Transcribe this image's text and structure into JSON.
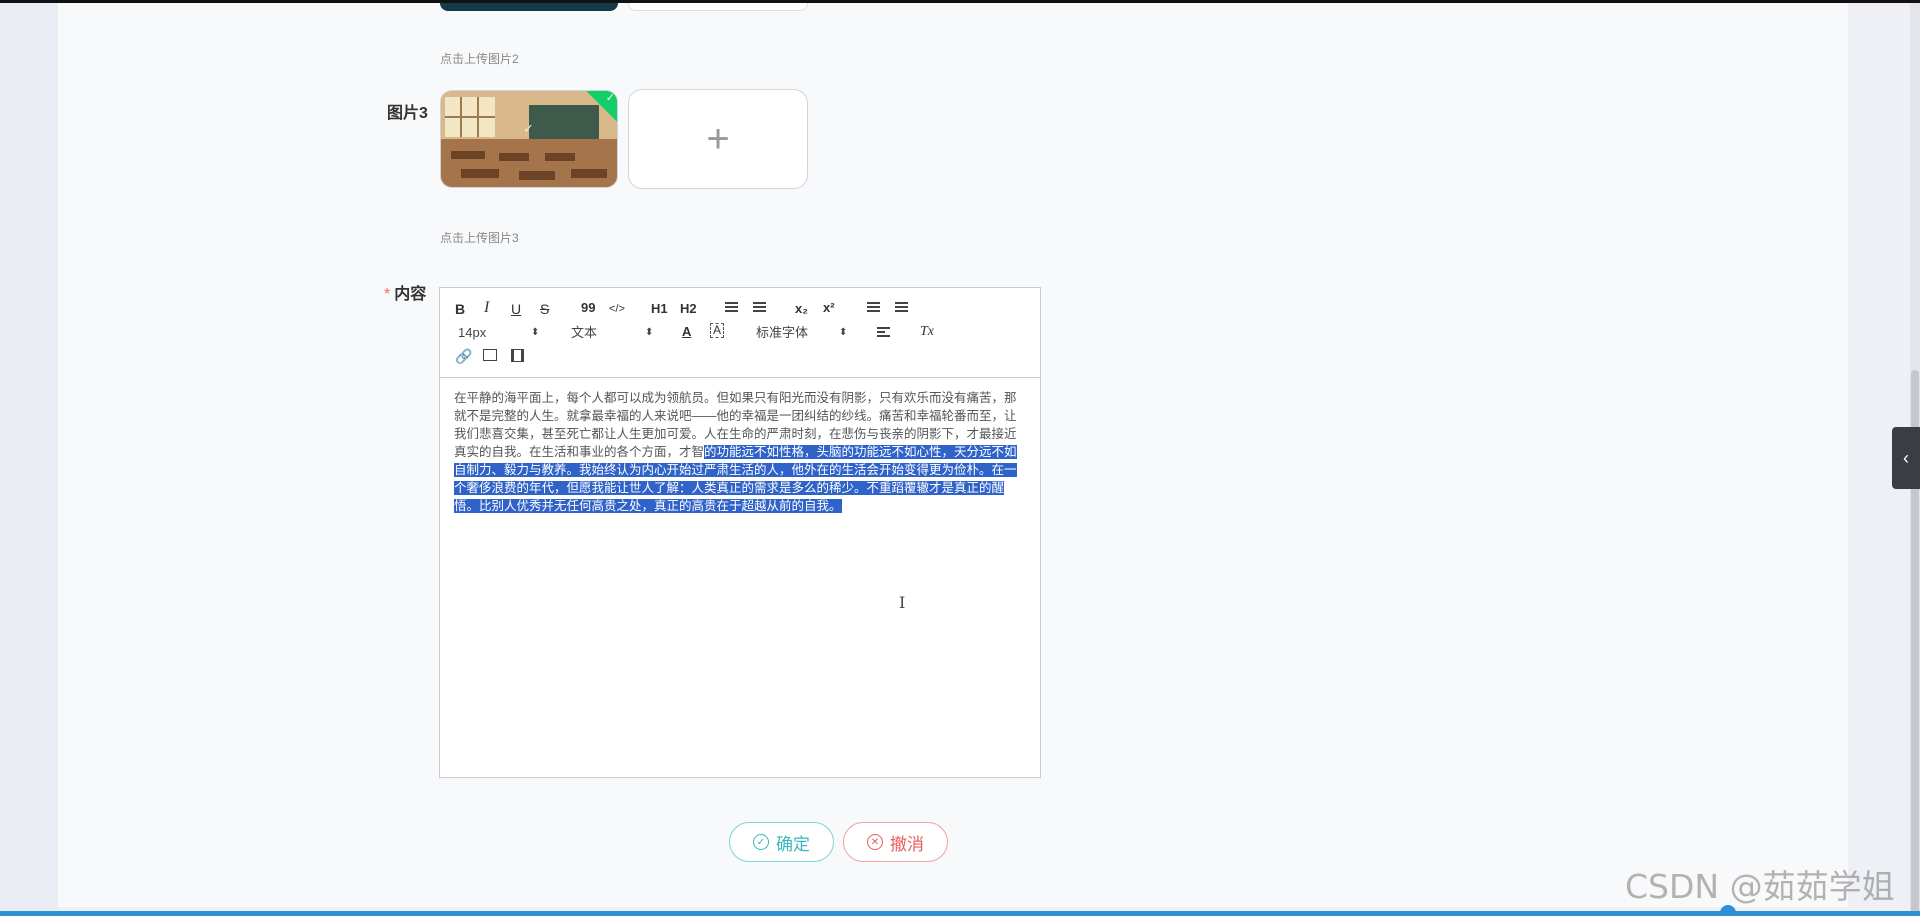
{
  "upload": {
    "hint2": "点击上传图片2",
    "label3": "图片3",
    "hint3": "点击上传图片3",
    "add_symbol": "+"
  },
  "content_field": {
    "required_mark": "*",
    "label": "内容"
  },
  "toolbar": {
    "bold": "B",
    "italic": "I",
    "underline": "U",
    "strike": "S",
    "quote": "99",
    "code": "</>",
    "h1": "H1",
    "h2": "H2",
    "sub": "x₂",
    "sup": "x²",
    "font_size": "14px",
    "header_select": "文本",
    "font_family": "标准字体",
    "color_letter": "A",
    "clear": "Tx",
    "icons": [
      "bold-icon",
      "italic-icon",
      "underline-icon",
      "strike-icon",
      "blockquote-icon",
      "code-block-icon",
      "header1-icon",
      "header2-icon",
      "ordered-list-icon",
      "bullet-list-icon",
      "subscript-icon",
      "superscript-icon",
      "outdent-icon",
      "indent-icon",
      "font-color-icon",
      "background-color-icon",
      "align-icon",
      "clean-format-icon",
      "link-icon",
      "image-icon",
      "video-icon"
    ]
  },
  "editor": {
    "text_plain": "在平静的海平面上，每个人都可以成为领航员。但如果只有阳光而没有阴影，只有欢乐而没有痛苦，那就不是完整的人生。就拿最幸福的人来说吧——他的幸福是一团纠结的纱线。痛苦和幸福轮番而至，让我们悲喜交集，甚至死亡都让人生更加可爱。人在生命的严肃时刻，在悲伤与丧亲的阴影下，才最接近真实的自我。在生活和事业的各个方面，才智",
    "text_selected": "的功能远不如性格，头脑的功能远不如心性，天分远不如自制力、毅力与教养。我始终认为内心开始过严肃生活的人，他外在的生活会开始变得更为俭朴。在一个奢侈浪费的年代，但愿我能让世人了解：人类真正的需求是多么的稀少。不重蹈覆辙才是真正的醒悟。比别人优秀并无任何高贵之处，真正的高贵在于超越从前的自我。"
  },
  "buttons": {
    "confirm": "确定",
    "cancel": "撤消"
  },
  "watermark": "CSDN @茹茹学姐",
  "colors": {
    "confirm": "#3cb6bd",
    "cancel": "#e95c5c",
    "selection": "#2f63c9",
    "upload_success": "#13ce66"
  }
}
